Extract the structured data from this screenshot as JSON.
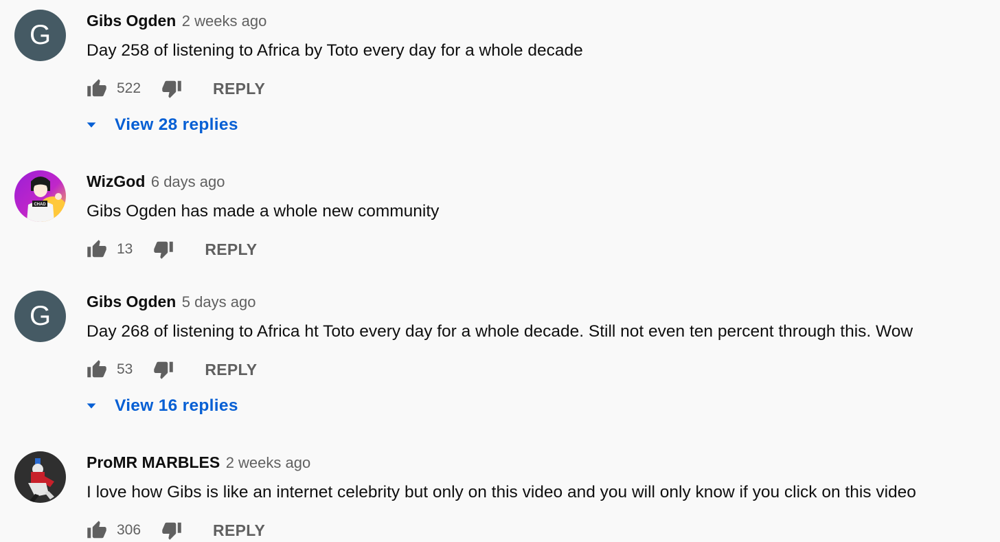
{
  "comments": [
    {
      "author": "Gibs Ogden",
      "time": "2 weeks ago",
      "avatar_letter": "G",
      "text": "Day 258 of listening to Africa by Toto every day for a whole decade",
      "likes": "522",
      "reply_label": "REPLY",
      "view_replies": "View 28 replies"
    },
    {
      "author": "WizGod",
      "time": "6 days ago",
      "avatar_text": "CHAD",
      "text": "Gibs Ogden has made a whole new community",
      "likes": "13",
      "reply_label": "REPLY"
    },
    {
      "author": "Gibs Ogden",
      "time": "5 days ago",
      "avatar_letter": "G",
      "text": "Day 268 of listening to Africa ht Toto every day for a whole decade. Still not even ten percent through this. Wow",
      "likes": "53",
      "reply_label": "REPLY",
      "view_replies": "View 16 replies"
    },
    {
      "author": "ProMR MARBLES",
      "time": "2 weeks ago",
      "text": "I love how Gibs is like an internet celebrity but only on this video and you will only know if you click on this video",
      "likes": "306",
      "reply_label": "REPLY"
    }
  ],
  "icons": {
    "like": "thumb-up-icon",
    "dislike": "thumb-down-icon",
    "expand": "caret-down-icon"
  },
  "colors": {
    "background": "#f9f9f9",
    "avatar_letter_bg": "#455a64",
    "link_blue": "#065fd4",
    "secondary_text": "#606060",
    "icon_gray": "#606060"
  }
}
